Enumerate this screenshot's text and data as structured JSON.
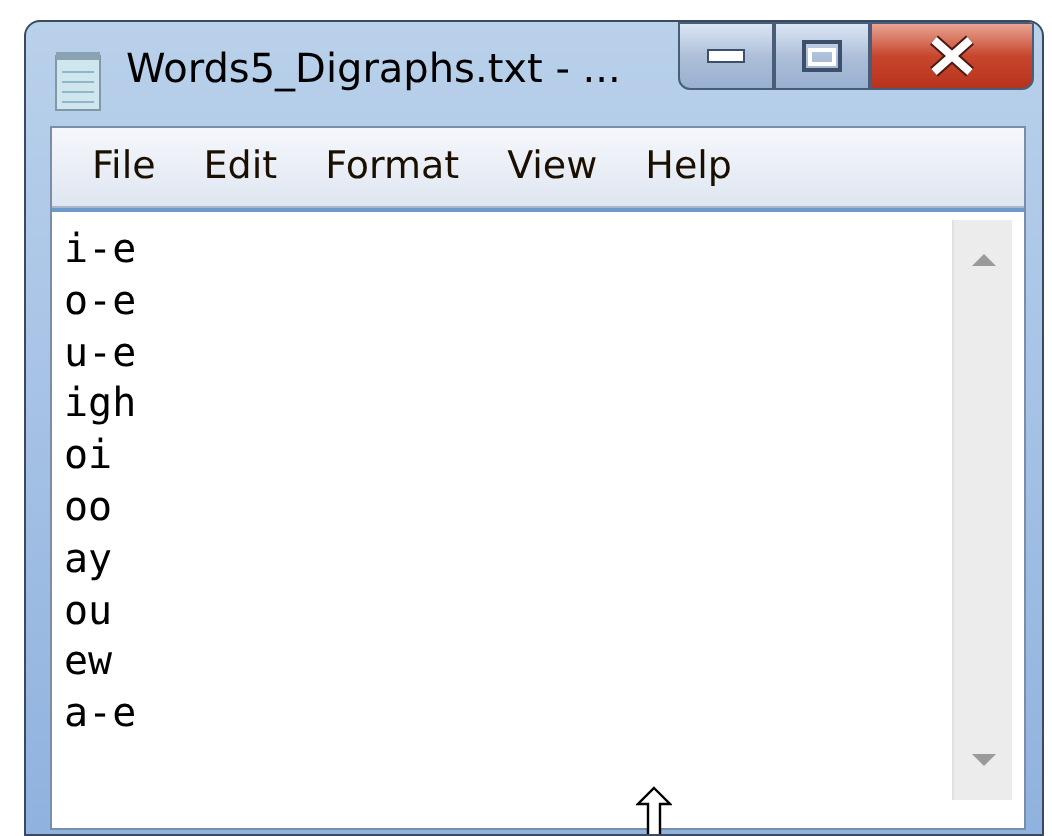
{
  "window": {
    "title": "Words5_Digraphs.txt - ..."
  },
  "menu": [
    "File",
    "Edit",
    "Format",
    "View",
    "Help"
  ],
  "document": {
    "lines": [
      "i-e",
      "o-e",
      "u-e",
      "igh",
      "oi",
      "oo",
      "ay",
      "ou",
      "ew",
      "a-e"
    ]
  }
}
